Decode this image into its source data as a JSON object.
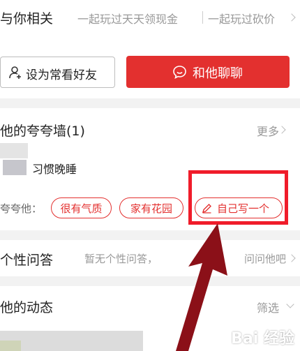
{
  "related": {
    "title": "与你相关",
    "item_1": "一起玩过天天领现金",
    "item_2": "一起玩过砍价",
    "follow_label": "设为常看好友",
    "chat_label": "和他聊聊"
  },
  "praise_wall": {
    "title": "他的夸夸墙(1)",
    "more": "更多",
    "entry_text": "习惯晚睡",
    "prompt": "夸夸他：",
    "tags": [
      "很有气质",
      "家有花园"
    ],
    "write_label": "自己写一个"
  },
  "qa": {
    "title": "个性问答",
    "empty_text_left": "暂无个性问答，",
    "empty_text_right": "问问他吧"
  },
  "moments": {
    "title": "他的动态",
    "filter": "筛选"
  },
  "watermark": "Bai 经验",
  "colors": {
    "accent": "#e3302f",
    "highlight": "#f01c2a",
    "arrow": "#8b1018"
  }
}
